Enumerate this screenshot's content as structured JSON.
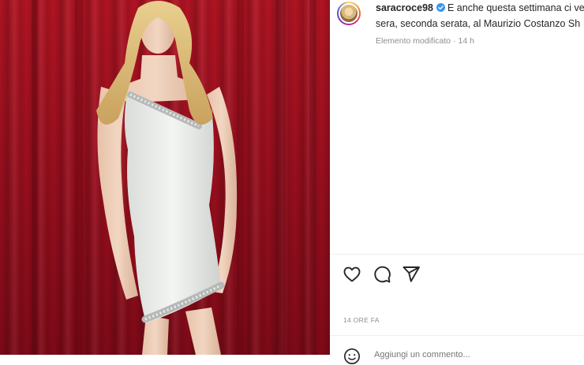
{
  "post": {
    "image_alt": "Woman in white one-shoulder mini dress in front of red curtain",
    "username": "saracroce98",
    "caption_line1_rest": "E anche questa settimana ci ve",
    "caption_line2": "sera, seconda serata, al Maurizio Costanzo Sh",
    "edited_text": "Elemento modificato",
    "separator": "·",
    "edited_time": "14 h",
    "timestamp": "14 ORE FA",
    "comment_placeholder": "Aggiungi un commento..."
  },
  "colors": {
    "verified_blue": "#3897f0",
    "text_primary": "#262626",
    "text_secondary": "#8e8e8e",
    "curtain_red": "#9a0f1e"
  },
  "icons": {
    "like": "heart-icon",
    "comment": "comment-icon",
    "share": "paper-plane-icon",
    "verified": "verified-badge-icon",
    "emoji": "emoji-icon"
  }
}
